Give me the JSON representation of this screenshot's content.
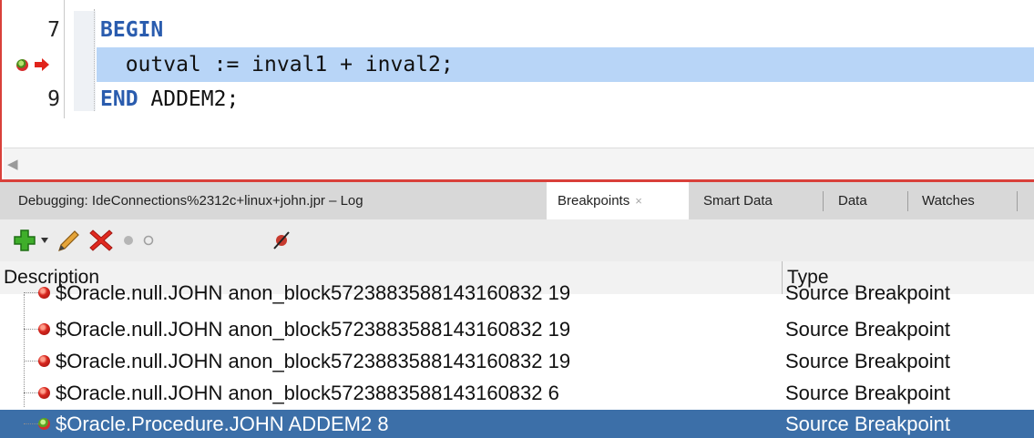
{
  "editor": {
    "lines": [
      {
        "num": "7",
        "keyword": "BEGIN",
        "rest": ""
      },
      {
        "num": "",
        "keyword": "",
        "rest": "  outval := inval1 + inval2;",
        "highlighted": true,
        "breakpoint": true,
        "execution_point": true
      },
      {
        "num": "9",
        "keyword": "END",
        "rest": " ADDEM2;"
      }
    ],
    "scroll_left_icon": "chevron-left-icon"
  },
  "tabs": [
    {
      "label": "Debugging: IdeConnections%2312c+linux+john.jpr – Log"
    },
    {
      "label": "Breakpoints",
      "active": true,
      "close": "×"
    },
    {
      "label": "Smart Data"
    },
    {
      "label": "Data"
    },
    {
      "label": "Watches"
    }
  ],
  "toolbar": {
    "icons": [
      "add-breakpoint-icon",
      "dropdown-arrow-icon",
      "edit-pencil-icon",
      "delete-x-icon",
      "enable-dot-icon",
      "disable-dot-icon",
      "deactivate-all-icon"
    ]
  },
  "table": {
    "columns": [
      "Description",
      "Type"
    ],
    "rows": [
      {
        "description": "$Oracle.null.JOHN anon_block5723883588143160832 19",
        "type": "Source Breakpoint"
      },
      {
        "description": "$Oracle.null.JOHN anon_block5723883588143160832 19",
        "type": "Source Breakpoint"
      },
      {
        "description": "$Oracle.null.JOHN anon_block5723883588143160832 19",
        "type": "Source Breakpoint"
      },
      {
        "description": "$Oracle.null.JOHN anon_block5723883588143160832 6",
        "type": "Source Breakpoint"
      },
      {
        "description": "$Oracle.Procedure.JOHN ADDEM2 8",
        "type": "Source Breakpoint",
        "selected": true
      }
    ]
  },
  "colors": {
    "keyword": "#2a5cae",
    "line_highlight": "#b8d5f7",
    "selection": "#3c6fa8",
    "accent_border": "#d9403a"
  }
}
